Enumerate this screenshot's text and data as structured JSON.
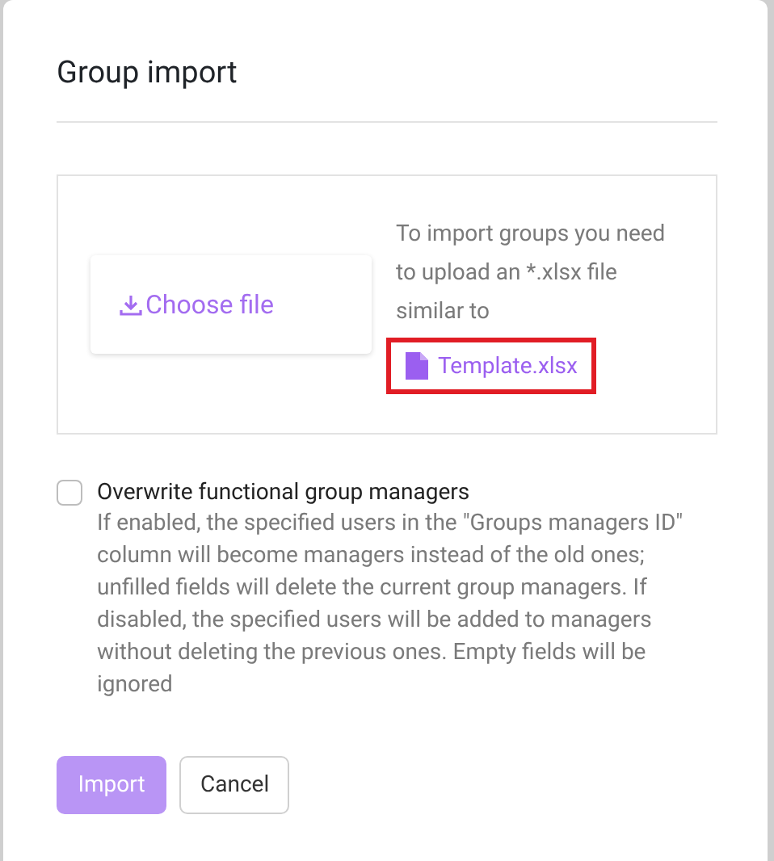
{
  "dialog": {
    "title": "Group import"
  },
  "upload": {
    "choose_button": "Choose file",
    "instructions": "To import groups you need to upload an *.xlsx file similar to",
    "template_link": "Template.xlsx",
    "highlighted": true
  },
  "overwrite": {
    "label": "Overwrite functional group managers",
    "checked": false,
    "description": "If enabled, the specified users in the \"Groups managers ID\" column will become managers instead of the old ones; unfilled fields will delete the current group managers. If disabled, the specified users will be added to managers without deleting the previous ones. Empty fields will be ignored"
  },
  "buttons": [
    {
      "label": "Import",
      "kind": "primary",
      "disabled": true
    },
    {
      "label": "Cancel",
      "kind": "secondary",
      "disabled": false
    }
  ]
}
